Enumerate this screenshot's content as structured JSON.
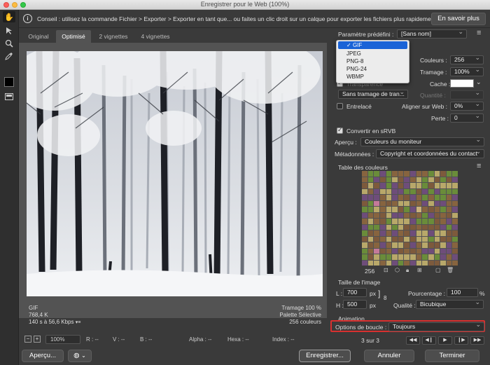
{
  "window": {
    "title": "Enregistrer pour le Web (100%)"
  },
  "toolbar": {
    "tools": [
      "hand-icon",
      "slice-select-icon",
      "zoom-icon",
      "eyedropper-icon"
    ]
  },
  "infobar": {
    "message": "Conseil : utilisez la commande Fichier > Exporter > Exporter en tant que... ou faites un clic droit sur un calque pour exporter les fichiers plus rapidement.",
    "button": "En savoir plus"
  },
  "tabs": [
    "Original",
    "Optimisé",
    "2 vignettes",
    "4 vignettes"
  ],
  "image_info": {
    "format": "GIF",
    "size": "768,4 K",
    "speed": "140 s à 56,6 Kbps",
    "quality": "Tramage 100 %",
    "palette": "Palette Sélective",
    "colors": "256 couleurs"
  },
  "statusbar": {
    "zoom": "100%",
    "r": "R : --",
    "v": "V : --",
    "b": "B : --",
    "alpha": "Alpha : --",
    "hexa": "Hexa : --",
    "index": "Index : --"
  },
  "bottom": {
    "preview": "Aperçu...",
    "save": "Enregistrer...",
    "cancel": "Annuler",
    "done": "Terminer"
  },
  "settings": {
    "preset_label": "Paramètre prédéfini :",
    "preset_value": "[Sans nom]",
    "format_options": [
      "GIF",
      "JPEG",
      "PNG-8",
      "PNG-24",
      "WBMP"
    ],
    "format_selected": "GIF",
    "colors_label": "Couleurs :",
    "colors_value": "256",
    "dither_label": "Tramage :",
    "dither_value": "100%",
    "matte_label": "Cache :",
    "transparency_label": "Transparence",
    "transp_dither_value": "Sans tramage de tran...",
    "amount_label": "Quantité :",
    "interlaced_label": "Entrelacé",
    "web_snap_label": "Aligner sur Web :",
    "web_snap_value": "0%",
    "lossy_label": "Perte :",
    "lossy_value": "0",
    "srgb_label": "Convertir en sRVB",
    "preview_label": "Aperçu :",
    "preview_value": "Couleurs du moniteur",
    "metadata_label": "Métadonnées :",
    "metadata_value": "Copyright et coordonnées du contact",
    "color_table_label": "Table des couleurs",
    "color_count": "256"
  },
  "image_size": {
    "header": "Taille de l'image",
    "w_label": "L :",
    "w_value": "700",
    "h_label": "H :",
    "h_value": "500",
    "unit": "px",
    "percent_label": "Pourcentage :",
    "percent_value": "100",
    "percent_unit": "%",
    "quality_label": "Qualité :",
    "quality_value": "Bicubique"
  },
  "animation": {
    "header": "Animation",
    "loop_label": "Options de boucle :",
    "loop_value": "Toujours",
    "frame_counter": "3 sur 3"
  },
  "colors": {
    "highlight": "#d8302f",
    "menu_selected": "#1a63d7"
  }
}
